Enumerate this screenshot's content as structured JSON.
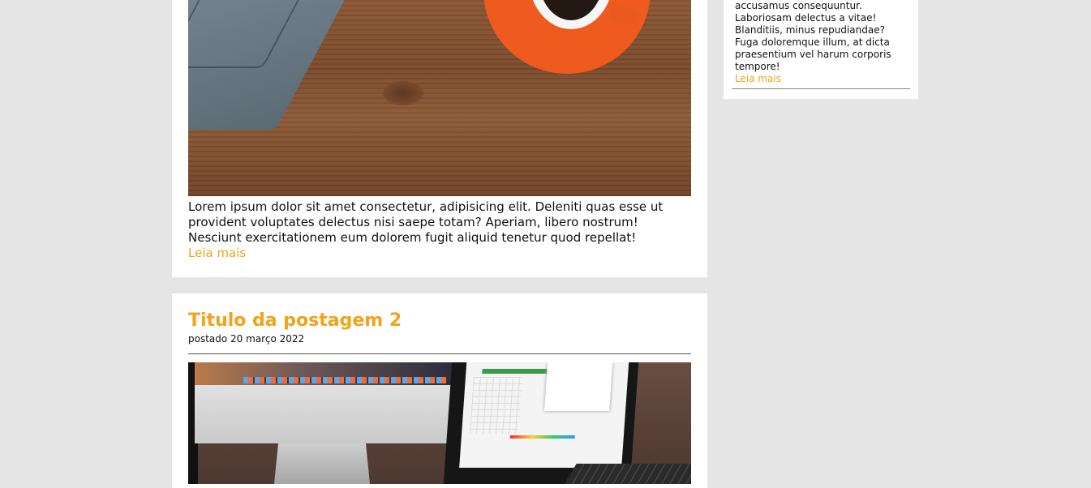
{
  "posts": [
    {
      "excerpt": "Lorem ipsum dolor sit amet consectetur, adipisicing elit. Deleniti quas esse ut provident voluptates delectus nisi saepe totam? Aperiam, libero nostrum! Nesciunt exercitationem eum dolorem fugit aliquid tenetur quod repellat!",
      "read_more": "Leia mais"
    },
    {
      "title": "Titulo da postagem 2",
      "meta": "postado 20 março 2022"
    }
  ],
  "sidebar": {
    "text": "accusamus consequuntur. Laboriosam delectus a vitae! Blanditiis, minus repudiandae? Fuga doloremque illum, at dicta praesentium vel harum corporis tempore!",
    "read_more": "Leia mais"
  },
  "colors": {
    "background": "#e5e5e5",
    "accent": "#f0a31b"
  },
  "icons": {
    "apple_logo": "apple-logo-icon"
  }
}
